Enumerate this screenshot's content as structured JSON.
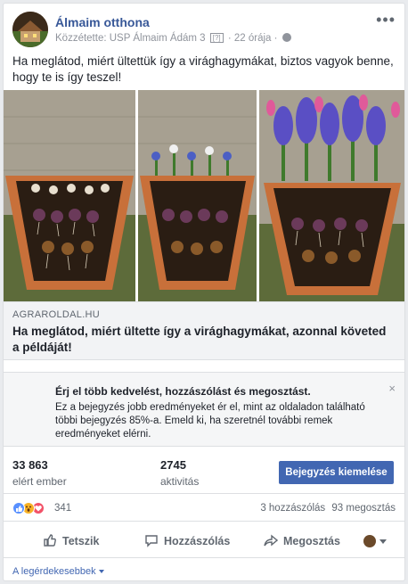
{
  "post": {
    "page_name": "Álmaim otthona",
    "meta_prefix": "Közzétette: USP Álmaim Ádám 3",
    "meta_q": "[?]",
    "meta_time": "· 22 órája ·",
    "text": "Ha meglátod, miért ültettük így a virághagymákat, biztos vagyok benne, hogy te is így teszel!"
  },
  "link": {
    "domain": "AGRAROLDAL.HU",
    "title": "Ha meglátod, miért ültette így a virághagymákat, azonnal követed a példáját!"
  },
  "promo": {
    "title": "Érj el több kedvelést, hozzászólást és megosztást.",
    "body": "Ez a bejegyzés jobb eredményeket ér el, mint az oldaladon található többi bejegyzés 85%-a. Emeld ki, ha szeretnél további remek eredményeket elérni.",
    "close": "×"
  },
  "stats": {
    "reach_value": "33 863",
    "reach_label": "elért ember",
    "activity_value": "2745",
    "activity_label": "aktivitás",
    "boost_label": "Bejegyzés kiemelése"
  },
  "reactions": {
    "count": "341",
    "comments": "3 hozzászólás",
    "shares": "93 megosztás",
    "icons": [
      "like-icon",
      "wow-icon",
      "love-icon"
    ]
  },
  "actions": {
    "like": "Tetszik",
    "comment": "Hozzászólás",
    "share": "Megosztás"
  },
  "footer": {
    "sort": "A legérdekesebbek"
  },
  "colors": {
    "link_blue": "#385898",
    "button_blue": "#4267b2",
    "hyacinth": "#5a4fc4",
    "tulip": "#e05a9a",
    "pot": "#c8703a"
  }
}
